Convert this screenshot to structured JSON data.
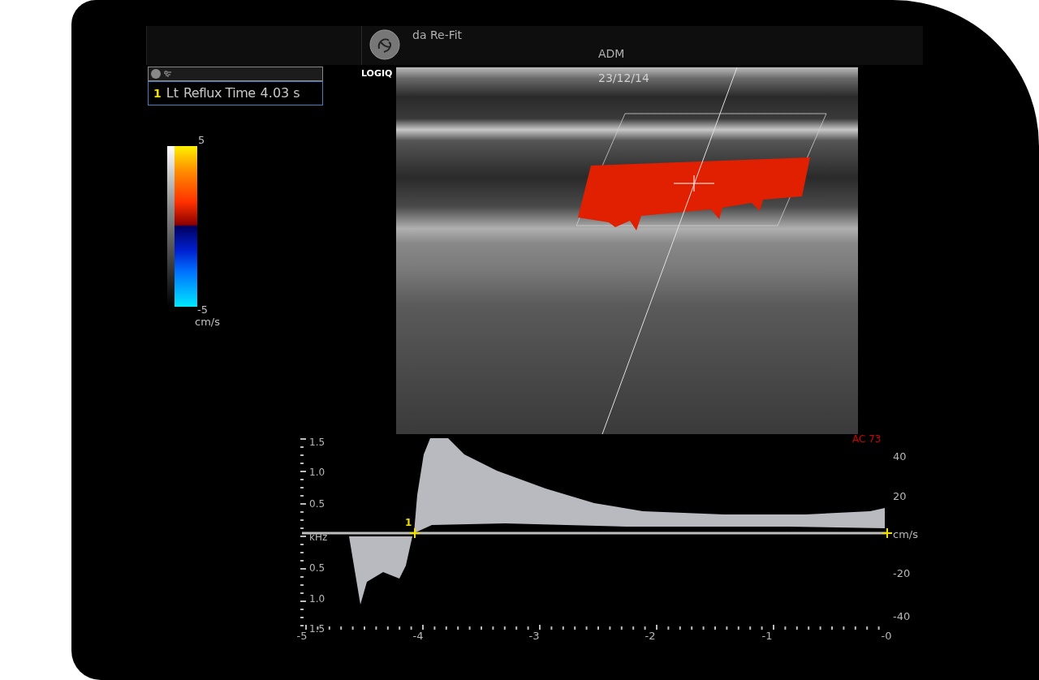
{
  "header": {
    "patient": "da Re-Fit",
    "operator": "ADM"
  },
  "measurement": {
    "index": "1",
    "side": "Lt",
    "label": "Reflux Time",
    "value": "4.03 s"
  },
  "brand": "LOGIQ",
  "date": "23/12/14",
  "color_scale": {
    "max": "5",
    "min": "-5",
    "unit": "cm/s"
  },
  "spectrum": {
    "annotation": "AC 73",
    "marker": "1",
    "left_axis": [
      "1.5",
      "1.0",
      "0.5",
      "kHz",
      "0.5",
      "1.0",
      "1.5"
    ],
    "right_axis": [
      "40",
      "20",
      "cm/s",
      "-20",
      "-40"
    ],
    "time_axis": [
      "-5",
      "-4",
      "-3",
      "-2",
      "-1",
      "-0"
    ]
  }
}
